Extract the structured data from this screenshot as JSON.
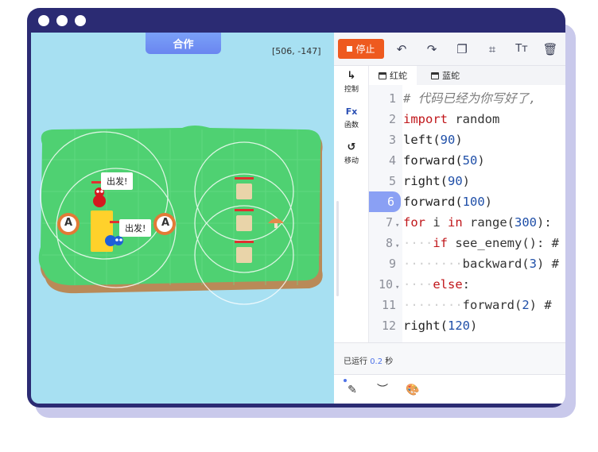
{
  "game": {
    "mode_tab": "合作",
    "coords": "[506, -147]",
    "speech_red": "出发!",
    "speech_blue": "出发!",
    "base_letter_left": "A",
    "base_letter_right": "A"
  },
  "toolbar": {
    "stop_label": "停止"
  },
  "sidebar": {
    "items": [
      {
        "label": "控制"
      },
      {
        "label": "函数"
      },
      {
        "label": "移动"
      }
    ],
    "func_icon": "Fx"
  },
  "tabs": [
    {
      "label": "红蛇"
    },
    {
      "label": "蓝蛇"
    }
  ],
  "code": {
    "current_line": 6,
    "lines": [
      {
        "n": "1"
      },
      {
        "n": "2"
      },
      {
        "n": "3"
      },
      {
        "n": "4"
      },
      {
        "n": "5"
      },
      {
        "n": "6"
      },
      {
        "n": "7"
      },
      {
        "n": "8"
      },
      {
        "n": "9"
      },
      {
        "n": "10"
      },
      {
        "n": "11"
      },
      {
        "n": "12"
      }
    ],
    "t1": "# 代码已经为你写好了,",
    "t2a": "import",
    "t2b": " random",
    "t3a": "left(",
    "t3b": "90",
    "t3c": ")",
    "t4a": "forward(",
    "t4b": "50",
    "t4c": ")",
    "t5a": "right(",
    "t5b": "90",
    "t5c": ")",
    "t6a": "forward(",
    "t6b": "100",
    "t6c": ")",
    "t7a": "for",
    "t7b": " i ",
    "t7c": "in",
    "t7d": " range(",
    "t7e": "300",
    "t7f": "):",
    "t8a": "if",
    "t8b": " see_enemy(): #",
    "t9a": "backward(",
    "t9b": "3",
    "t9c": ") #",
    "t10a": "else",
    "t10b": ":",
    "t11a": "forward(",
    "t11b": "2",
    "t11c": ") #",
    "t12a": "right(",
    "t12b": "120",
    "t12c": ")"
  },
  "status": {
    "prefix": "已运行",
    "time": "0.2",
    "suffix": "秒"
  },
  "colors": {
    "frame": "#2b2b73",
    "stop": "#ee5a1f",
    "accent": "#8aa0f4",
    "water": "#a7e0f2",
    "grass": "#4fd172"
  }
}
